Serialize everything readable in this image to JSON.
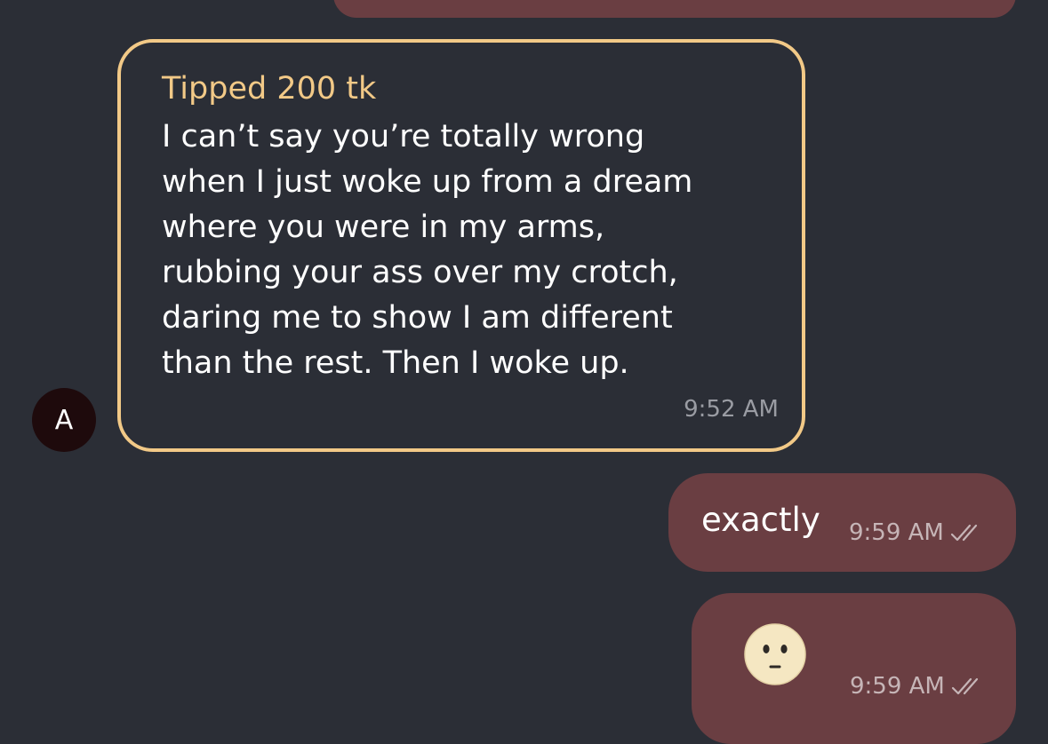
{
  "avatar": {
    "initial": "A"
  },
  "tip_message": {
    "label": "Tipped 200 tk",
    "text": "I can’t say you’re totally wrong\nwhen I just woke up from a dream\nwhere you were in my arms,\nrubbing your ass over my crotch,\ndaring me to show I am different\nthan the rest. Then I woke up.",
    "time": "9:52 AM"
  },
  "outgoing": [
    {
      "text": "exactly",
      "time": "9:59 AM",
      "status_icon": "double-check-icon"
    },
    {
      "emoji": "neutral-face-emoji",
      "time": "9:59 AM",
      "status_icon": "double-check-icon"
    }
  ],
  "colors": {
    "background": "#2b2e36",
    "outgoing_bubble": "#6a3e42",
    "tip_accent": "#f2c987",
    "avatar_bg": "#1e0a0c"
  }
}
